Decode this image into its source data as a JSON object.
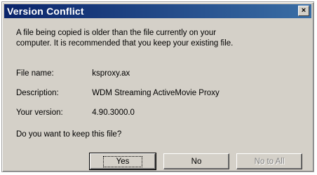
{
  "dialog": {
    "title": "Version Conflict",
    "close_glyph": "×",
    "message_line1": "A file being copied is older than the file currently on your",
    "message_line2": "computer. It is recommended that you keep your existing file.",
    "details": [
      {
        "label": "File name:",
        "value": "ksproxy.ax"
      },
      {
        "label": "Description:",
        "value": "WDM Streaming ActiveMovie Proxy"
      },
      {
        "label": "Your version:",
        "value": "4.90.3000.0"
      }
    ],
    "question": "Do you want to keep this file?",
    "buttons": {
      "yes": "Yes",
      "no": "No",
      "no_to_all": "No to All"
    }
  },
  "colors": {
    "titlebar_start": "#0a246a",
    "titlebar_end": "#3a6ea5",
    "face": "#d4d0c8"
  },
  "icons": {
    "close": "close-icon"
  }
}
